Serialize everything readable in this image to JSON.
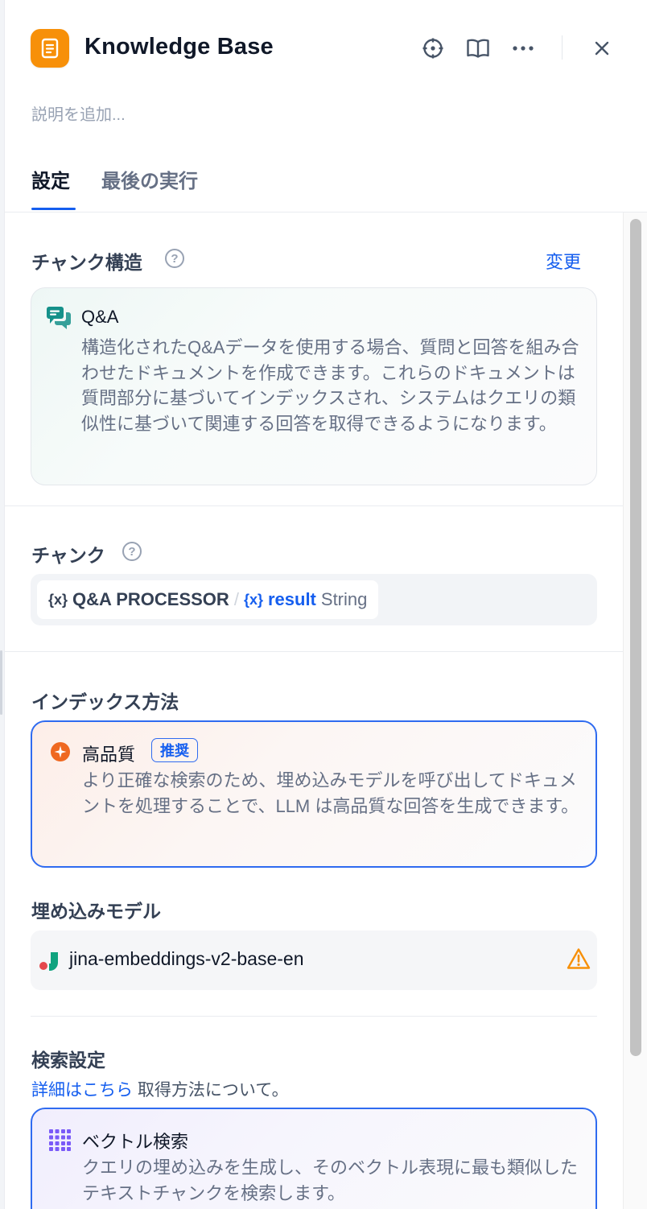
{
  "header": {
    "title": "Knowledge Base",
    "description_placeholder": "説明を追加...",
    "icons": {
      "app": "document-icon",
      "locate": "crosshair-icon",
      "docs": "book-icon",
      "more": "ellipsis-icon",
      "close": "close-icon"
    }
  },
  "tabs": [
    {
      "label": "設定",
      "active": true
    },
    {
      "label": "最後の実行",
      "active": false
    }
  ],
  "chunk_structure": {
    "label": "チャンク構造",
    "change_label": "変更",
    "card": {
      "title": "Q&A",
      "icon": "chat-bubbles-icon",
      "description": "構造化されたQ&Aデータを使用する場合、質問と回答を組み合わせたドキュメントを作成できます。これらのドキュメントは質問部分に基づいてインデックスされ、システムはクエリの類似性に基づいて関連する回答を取得できるようになります。"
    }
  },
  "chunk": {
    "label": "チャンク",
    "variable": {
      "node": "Q&A PROCESSOR",
      "separator": "/",
      "name": "result",
      "type": "String"
    }
  },
  "index_method": {
    "label": "インデックス方法",
    "option": {
      "title": "高品質",
      "badge": "推奨",
      "description": "より正確な検索のため、埋め込みモデルを呼び出してドキュメントを処理することで、LLM は高品質な回答を生成できます。",
      "selected": true
    }
  },
  "embedding_model": {
    "label": "埋め込みモデル",
    "model": "jina-embeddings-v2-base-en",
    "warning_icon": "warning-triangle-icon"
  },
  "retrieval": {
    "label": "検索設定",
    "learn_more_link": "詳細はこちら",
    "learn_more_suffix": " 取得方法について。",
    "option": {
      "title": "ベクトル検索",
      "icon": "grid-dots-icon",
      "description": "クエリの埋め込みを生成し、そのベクトル表現に最も類似したテキストチャンクを検索します。",
      "selected": true
    }
  },
  "colors": {
    "accent": "#155eef",
    "app_icon": "#f79009",
    "qa_icon": "#15918a",
    "warning": "#f79009",
    "quality_icon": "#ef6820",
    "vector_icon": "#7a5af8"
  }
}
